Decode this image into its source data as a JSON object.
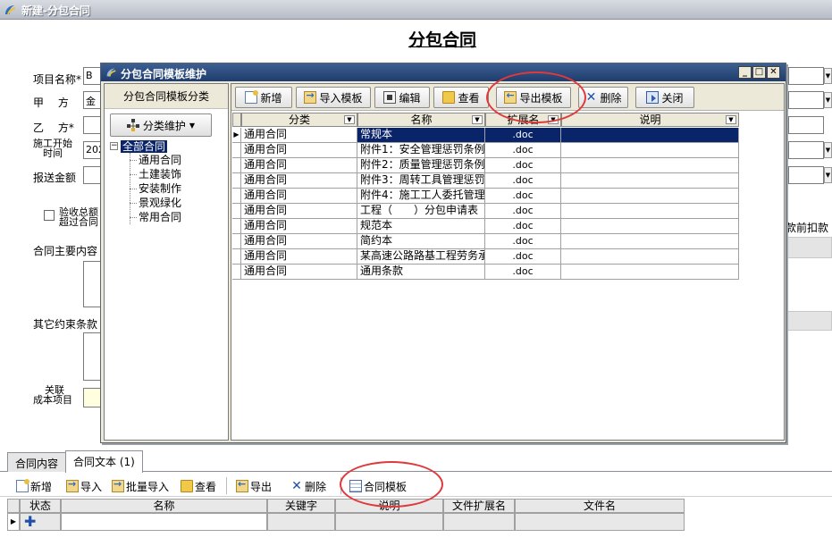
{
  "window": {
    "title": "新建-分包合同"
  },
  "page": {
    "title": "分包合同"
  },
  "form": {
    "project_name_label": "项目名称*",
    "project_name_value": "B",
    "party_a_label": "甲　 方",
    "party_a_value": "金",
    "party_b_label": "乙　 方*",
    "start_time_label_1": "施工开始",
    "start_time_label_2": "时间",
    "start_time_value": "202",
    "amount_label": "报送金额",
    "acceptance_label_1": "验收总额",
    "acceptance_label_2": "超过合同",
    "deduction_suffix": "款前扣款",
    "main_content_label": "合同主要内容",
    "other_terms_label": "其它约束条款",
    "related_label_1": "关联",
    "related_label_2": "成本项目"
  },
  "tabs": [
    {
      "label": "合同内容",
      "active": false
    },
    {
      "label": "合同文本 (1)",
      "active": true
    }
  ],
  "bottom_toolbar": {
    "new": "新增",
    "import": "导入",
    "batch_import": "批量导入",
    "view": "查看",
    "export": "导出",
    "delete": "删除",
    "template": "合同模板"
  },
  "bottom_grid": {
    "columns": [
      "状态",
      "名称",
      "关键字",
      "说明",
      "文件扩展名",
      "文件名"
    ]
  },
  "dialog": {
    "title": "分包合同模板维护",
    "left_header": "分包合同模板分类",
    "category_button": "分类维护",
    "tree": {
      "root": "全部合同",
      "children": [
        "通用合同",
        "土建装饰",
        "安装制作",
        "景观绿化",
        "常用合同"
      ]
    },
    "toolbar": {
      "new": "新增",
      "import_template": "导入模板",
      "edit": "编辑",
      "view": "查看",
      "export_template": "导出模板",
      "delete": "删除",
      "close": "关闭"
    },
    "grid": {
      "columns": [
        "分类",
        "名称",
        "扩展名",
        "说明"
      ],
      "rows": [
        {
          "category": "通用合同",
          "name": "常规本",
          "ext": ".doc",
          "note": ""
        },
        {
          "category": "通用合同",
          "name": "附件1：安全管理惩罚条例",
          "ext": ".doc",
          "note": ""
        },
        {
          "category": "通用合同",
          "name": "附件2：质量管理惩罚条例",
          "ext": ".doc",
          "note": ""
        },
        {
          "category": "通用合同",
          "name": "附件3：周转工具管理惩罚",
          "ext": ".doc",
          "note": ""
        },
        {
          "category": "通用合同",
          "name": "附件4：施工工人委托管理",
          "ext": ".doc",
          "note": ""
        },
        {
          "category": "通用合同",
          "name": "工程（　　）分包申请表",
          "ext": ".doc",
          "note": ""
        },
        {
          "category": "通用合同",
          "name": "规范本",
          "ext": ".doc",
          "note": ""
        },
        {
          "category": "通用合同",
          "name": "简约本",
          "ext": ".doc",
          "note": ""
        },
        {
          "category": "通用合同",
          "name": "某高速公路路基工程劳务承",
          "ext": ".doc",
          "note": ""
        },
        {
          "category": "通用合同",
          "name": "通用条款",
          "ext": ".doc",
          "note": ""
        }
      ]
    }
  },
  "icons": {
    "app": "app-logo-icon",
    "dropdown": "chevron-down-icon"
  },
  "colors": {
    "selection": "#0a246a",
    "dialog_title": "#1f3d6e",
    "annotation": "#e0393c"
  }
}
